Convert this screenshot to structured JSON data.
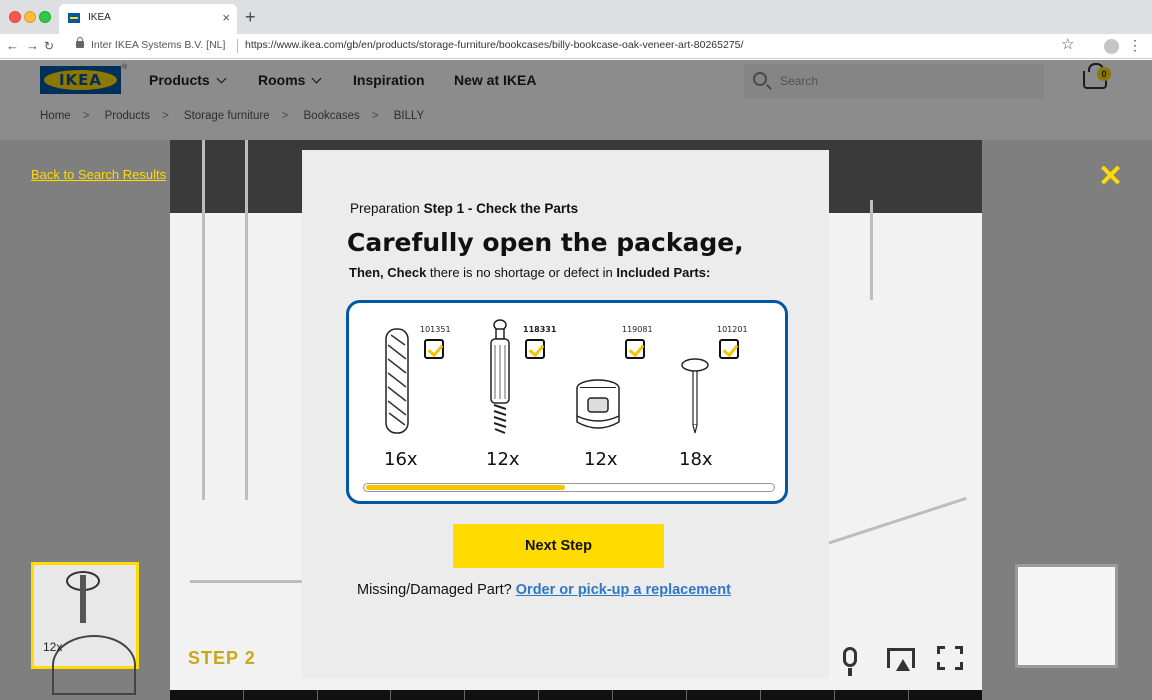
{
  "browser": {
    "tab_title": "IKEA",
    "tab_close": "×",
    "new_tab": "+",
    "back": "←",
    "forward": "→",
    "reload": "↻",
    "site_identity": "Inter IKEA Systems B.V. [NL]",
    "url": "https://www.ikea.com/gb/en/products/storage-furniture/bookcases/billy-bookcase-oak-veneer-art-80265275/",
    "bookmark": "☆",
    "menu": "⋮"
  },
  "site": {
    "logo": "IKEA",
    "logo_reg": "®",
    "nav": [
      {
        "label": "Products",
        "has_menu": true
      },
      {
        "label": "Rooms",
        "has_menu": true
      },
      {
        "label": "Inspiration",
        "has_menu": false
      },
      {
        "label": "New at IKEA",
        "has_menu": false
      }
    ],
    "search_placeholder": "Search",
    "cart_count": "0",
    "breadcrumbs": [
      "Home",
      "Products",
      "Storage furniture",
      "Bookcases",
      "BILLY"
    ],
    "breadcrumb_separator": ">"
  },
  "viewer": {
    "back_link": "Back to Search Results",
    "close_icon": "✕",
    "thumbnail_qty": "12x",
    "step_label": "STEP 2",
    "accent_color": "#ffdb00"
  },
  "modal": {
    "prefix": "Preparation",
    "step_title": "Step 1 - Check the Parts",
    "heading": "Carefully open the package,",
    "check_then": "Then, Check",
    "check_middle": "there is no shortage or defect in",
    "check_parts": "Included Parts:",
    "parts": [
      {
        "code": "101351",
        "qty": "16x",
        "checked": true,
        "icon": "wooden-dowel-icon"
      },
      {
        "code": "118331",
        "qty": "12x",
        "checked": true,
        "icon": "cam-bolt-icon"
      },
      {
        "code": "119081",
        "qty": "12x",
        "checked": true,
        "icon": "cam-lock-nut-icon"
      },
      {
        "code": "101201",
        "qty": "18x",
        "checked": true,
        "icon": "nail-icon"
      }
    ],
    "progress": 0.49,
    "next_button": "Next Step",
    "missing_text": "Missing/Damaged Part?",
    "replacement_link": "Order or pick-up a replacement",
    "border_color": "#0058a3",
    "link_color": "#2f78c4"
  }
}
